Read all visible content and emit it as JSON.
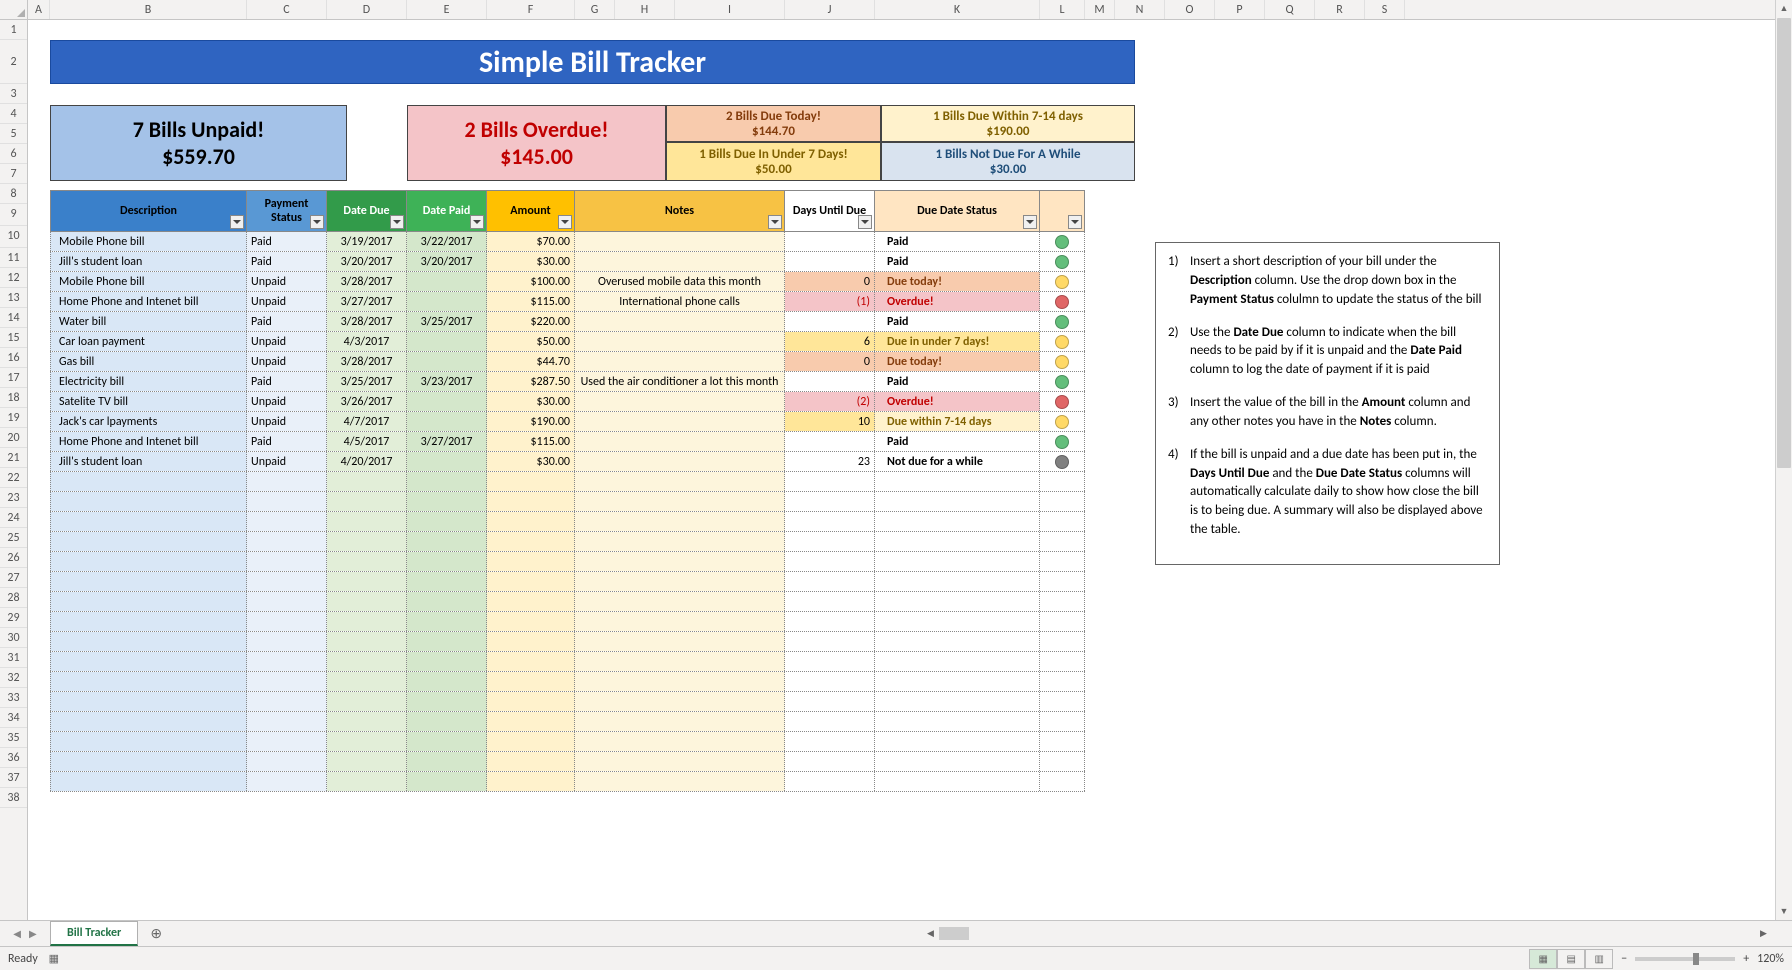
{
  "columns": [
    "A",
    "B",
    "C",
    "D",
    "E",
    "F",
    "G",
    "H",
    "I",
    "J",
    "K",
    "L",
    "M",
    "N",
    "O",
    "P",
    "Q",
    "R",
    "S"
  ],
  "row_count": 38,
  "title": "Simple Bill Tracker",
  "summary": {
    "unpaid_title": "7 Bills Unpaid!",
    "unpaid_amount": "$559.70",
    "overdue_title": "2 Bills Overdue!",
    "overdue_amount": "$145.00",
    "due_today_title": "2 Bills Due Today!",
    "due_today_amount": "$144.70",
    "due_7_title": "1 Bills Due In Under 7 Days!",
    "due_7_amount": "$50.00",
    "due_14_title": "1 Bills Due Within 7-14 days",
    "due_14_amount": "$190.00",
    "not_due_title": "1 Bills Not Due For A While",
    "not_due_amount": "$30.00"
  },
  "headers": {
    "description": "Description",
    "payment_status": "Payment Status",
    "date_due": "Date Due",
    "date_paid": "Date Paid",
    "amount": "Amount",
    "notes": "Notes",
    "days_until_due": "Days Until Due",
    "due_date_status": "Due Date Status"
  },
  "rows": [
    {
      "desc": "Mobile Phone bill",
      "status": "Paid",
      "date_due": "3/19/2017",
      "date_paid": "3/22/2017",
      "amount": "$70.00",
      "notes": "",
      "days": "",
      "due_status": "Paid",
      "dot": "green"
    },
    {
      "desc": "Jill's student loan",
      "status": "Paid",
      "date_due": "3/20/2017",
      "date_paid": "3/20/2017",
      "amount": "$30.00",
      "notes": "",
      "days": "",
      "due_status": "Paid",
      "dot": "green"
    },
    {
      "desc": "Mobile Phone bill",
      "status": "Unpaid",
      "date_due": "3/28/2017",
      "date_paid": "",
      "amount": "$100.00",
      "notes": "Overused mobile data this month",
      "days": "0",
      "due_status": "Due today!",
      "dot": "yellow",
      "days_hl": "orange",
      "status_hl": "orange"
    },
    {
      "desc": "Home Phone and Intenet bill",
      "status": "Unpaid",
      "date_due": "3/27/2017",
      "date_paid": "",
      "amount": "$115.00",
      "notes": "International phone calls",
      "days": "(1)",
      "due_status": "Overdue!",
      "dot": "red",
      "days_hl": "red",
      "status_hl": "red"
    },
    {
      "desc": "Water bill",
      "status": "Paid",
      "date_due": "3/28/2017",
      "date_paid": "3/25/2017",
      "amount": "$220.00",
      "notes": "",
      "days": "",
      "due_status": "Paid",
      "dot": "green"
    },
    {
      "desc": "Car loan payment",
      "status": "Unpaid",
      "date_due": "4/3/2017",
      "date_paid": "",
      "amount": "$50.00",
      "notes": "",
      "days": "6",
      "due_status": "Due in under 7 days!",
      "dot": "yellow",
      "days_hl": "yellow",
      "status_hl": "yellow"
    },
    {
      "desc": "Gas bill",
      "status": "Unpaid",
      "date_due": "3/28/2017",
      "date_paid": "",
      "amount": "$44.70",
      "notes": "",
      "days": "0",
      "due_status": "Due today!",
      "dot": "yellow",
      "days_hl": "orange",
      "status_hl": "orange"
    },
    {
      "desc": "Electricity bill",
      "status": "Paid",
      "date_due": "3/25/2017",
      "date_paid": "3/23/2017",
      "amount": "$287.50",
      "notes": "Used the air conditioner a lot this month",
      "days": "",
      "due_status": "Paid",
      "dot": "green"
    },
    {
      "desc": "Satelite TV bill",
      "status": "Unpaid",
      "date_due": "3/26/2017",
      "date_paid": "",
      "amount": "$30.00",
      "notes": "",
      "days": "(2)",
      "due_status": "Overdue!",
      "dot": "red",
      "days_hl": "red",
      "status_hl": "red"
    },
    {
      "desc": "Jack's car lpayments",
      "status": "Unpaid",
      "date_due": "4/7/2017",
      "date_paid": "",
      "amount": "$190.00",
      "notes": "",
      "days": "10",
      "due_status": "Due within 7-14 days",
      "dot": "yellow",
      "days_hl": "yellow",
      "status_hl": "lyellow"
    },
    {
      "desc": "Home Phone and Intenet bill",
      "status": "Paid",
      "date_due": "4/5/2017",
      "date_paid": "3/27/2017",
      "amount": "$115.00",
      "notes": "",
      "days": "",
      "due_status": "Paid",
      "dot": "green"
    },
    {
      "desc": "Jill's student loan",
      "status": "Unpaid",
      "date_due": "4/20/2017",
      "date_paid": "",
      "amount": "$30.00",
      "notes": "",
      "days": "23",
      "due_status": "Not due for a while",
      "dot": "gray"
    }
  ],
  "empty_rows": 16,
  "instructions": [
    {
      "prefix": "Insert a short description of your bill  under the ",
      "b1": "Description",
      "mid1": " column. Use the drop down box in the ",
      "b2": "Payment Status",
      "suffix": " colulmn to update the status of the bill"
    },
    {
      "prefix": "Use the ",
      "b1": "Date Due",
      "mid1": "  column to indicate when the bill needs to be paid by if it is unpaid and the ",
      "b2": "Date Paid",
      "suffix": " column to log the date of payment if it is paid"
    },
    {
      "prefix": "Insert the value of the bill in the ",
      "b1": "Amount",
      "mid1": " column and any other notes you have in the ",
      "b2": "Notes",
      "suffix": " column."
    },
    {
      "prefix": "If the bill is unpaid and a due date has been put in, the ",
      "b1": "Days Until Due",
      "mid1": " and the ",
      "b2": "Due Date Status",
      "suffix": " columns will automatically calculate daily to show how close the bill is to being due. A summary will also be displayed above the table."
    }
  ],
  "sheet": {
    "tab_name": "Bill Tracker"
  },
  "status": {
    "ready": "Ready",
    "zoom": "120%"
  }
}
